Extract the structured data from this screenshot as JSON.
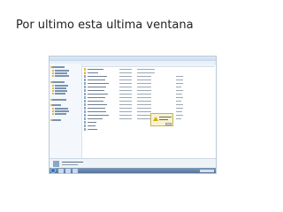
{
  "slide": {
    "title": "Por ultimo esta ultima ventana"
  },
  "screenshot": {
    "window": "windows-explorer",
    "dialog": {
      "icon": "warning-icon"
    },
    "taskbar": {
      "start_icon": "windows-start-icon"
    },
    "colors": {
      "accent": "#4d6c92",
      "dialog_bg": "#f7f3d2",
      "warning": "#e0a800",
      "folder": "#e1b94a"
    }
  }
}
